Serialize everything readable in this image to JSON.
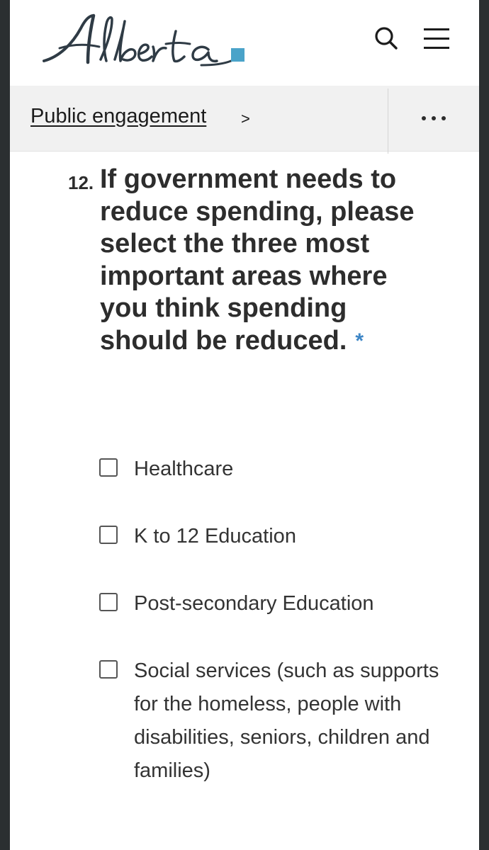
{
  "header": {
    "logo_text": "Alberta",
    "icons": [
      "search-icon",
      "menu-icon"
    ]
  },
  "breadcrumb": {
    "link_label": "Public engagement",
    "chevron": ">",
    "more_icon": "more-horizontal-icon"
  },
  "question": {
    "number": "12.",
    "text": "If government needs to reduce spending, please select the three most important areas where you think spending should be reduced.",
    "required_marker": "*"
  },
  "options": [
    {
      "label": "Healthcare",
      "checked": false
    },
    {
      "label": "K to 12 Education",
      "checked": false
    },
    {
      "label": "Post-secondary Education",
      "checked": false
    },
    {
      "label": "Social services (such as supports for the homeless, people with disabilities, seniors, children and families)",
      "checked": false
    }
  ],
  "colors": {
    "accent": "#3d86c6",
    "logo_square": "#4aa3c9",
    "text": "#2d2d2d",
    "bar_bg": "#f1f1f1"
  }
}
